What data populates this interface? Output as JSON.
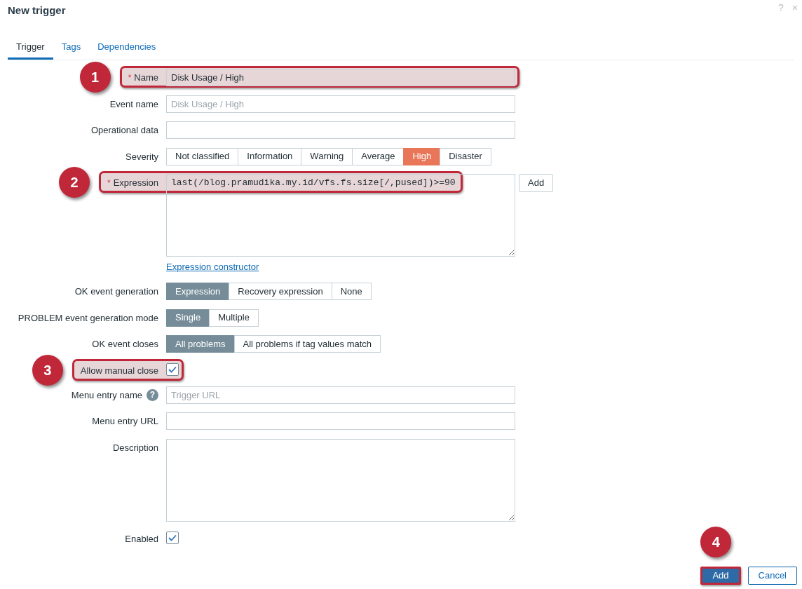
{
  "dialog": {
    "title": "New trigger",
    "header_buttons": [
      "?",
      "×"
    ]
  },
  "tabs": [
    {
      "label": "Trigger",
      "selected": true
    },
    {
      "label": "Tags",
      "selected": false
    },
    {
      "label": "Dependencies",
      "selected": false
    }
  ],
  "form": [
    {
      "kind": "text",
      "label": "Name",
      "required_mark": "*",
      "value": "Disk Usage / High",
      "highlighted": true,
      "callout": "1"
    },
    {
      "kind": "text",
      "label": "Event name",
      "placeholder": "Disk Usage / High",
      "highlighted": false
    },
    {
      "kind": "text",
      "label": "Operational data",
      "highlighted": false
    },
    {
      "kind": "severity",
      "label": "Severity",
      "options": [
        {
          "label": "Not classified",
          "selected": false
        },
        {
          "label": "Information",
          "selected": false
        },
        {
          "label": "Warning",
          "selected": false
        },
        {
          "label": "Average",
          "selected": false
        },
        {
          "label": "High",
          "selected": true
        },
        {
          "label": "Disaster",
          "selected": false
        }
      ]
    },
    {
      "kind": "textarea",
      "label": "Expression",
      "required_mark": "*",
      "value": "last(/blog.pramudika.my.id/vfs.fs.size[/,pused])>=90",
      "highlighted": true,
      "callout": "2",
      "side_button": "Add",
      "link": "Expression constructor"
    },
    {
      "kind": "segmented",
      "label": "OK event generation",
      "options": [
        {
          "label": "Expression",
          "selected": true
        },
        {
          "label": "Recovery expression",
          "selected": false
        },
        {
          "label": "None",
          "selected": false
        }
      ]
    },
    {
      "kind": "segmented",
      "label": "PROBLEM event generation mode",
      "options": [
        {
          "label": "Single",
          "selected": true
        },
        {
          "label": "Multiple",
          "selected": false
        }
      ]
    },
    {
      "kind": "segmented",
      "label": "OK event closes",
      "options": [
        {
          "label": "All problems",
          "selected": true
        },
        {
          "label": "All problems if tag values match",
          "selected": false
        }
      ]
    },
    {
      "kind": "checkbox",
      "label": "Allow manual close",
      "checked": true,
      "highlighted": true,
      "callout": "3"
    },
    {
      "kind": "text",
      "label": "Menu entry name",
      "help": "?",
      "placeholder": "Trigger URL",
      "highlighted": false
    },
    {
      "kind": "text",
      "label": "Menu entry URL",
      "highlighted": false
    },
    {
      "kind": "textarea",
      "label": "Description",
      "highlighted": false
    },
    {
      "kind": "checkbox",
      "label": "Enabled",
      "checked": true,
      "highlighted": false
    }
  ],
  "footer_buttons": [
    {
      "label": "Add",
      "primary": true,
      "highlighted": true,
      "callout": "4"
    },
    {
      "label": "Cancel",
      "primary": false,
      "highlighted": false
    }
  ]
}
